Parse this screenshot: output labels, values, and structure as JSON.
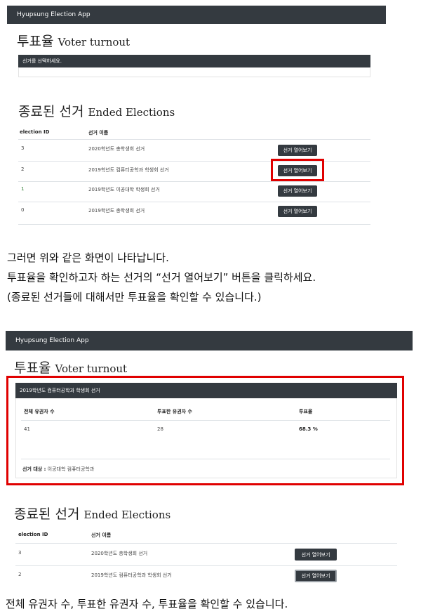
{
  "screen1": {
    "app_title": "Hyupsung Election App",
    "turnout_title_ko": "투표율",
    "turnout_title_en": "Voter turnout",
    "select_prompt": "선거를 선택하세요.",
    "ended_title_ko": "종료된 선거",
    "ended_title_en": "Ended Elections",
    "col_id": "election ID",
    "col_name": "선거 이름",
    "rows": [
      {
        "id": "3",
        "name": "2020학년도 총학생회 선거",
        "button": "선거 열어보기"
      },
      {
        "id": "2",
        "name": "2019학년도 컴퓨터공학과 학생회 선거",
        "button": "선거 열어보기"
      },
      {
        "id": "1",
        "name": "2019학년도 이공대학 학생회 선거",
        "button": "선거 열어보기"
      },
      {
        "id": "0",
        "name": "2019학년도 총학생회 선거",
        "button": "선거 열어보기"
      }
    ]
  },
  "instructions": {
    "line1": "그러면 위와 같은 화면이 나타납니다.",
    "line2": "투표율을 확인하고자 하는 선거의 “선거 열어보기” 버튼을 클릭하세요.",
    "line3": "(종료된 선거들에 대해서만 투표율을 확인할 수 있습니다.)"
  },
  "screen2": {
    "app_title": "Hyupsung Election App",
    "turnout_title_ko": "투표율",
    "turnout_title_en": "Voter turnout",
    "election_name": "2019학년도 컴퓨터공학과 학생회 선거",
    "stats_headers": {
      "total": "전체 유권자 수",
      "voted": "투표한 유권자 수",
      "rate": "투표율"
    },
    "stats_values": {
      "total": "41",
      "voted": "28",
      "rate": "68.3 %"
    },
    "target_label": "선거 대상 :",
    "target_value": "이공대학 컴퓨터공학과",
    "ended_title_ko": "종료된 선거",
    "ended_title_en": "Ended Elections",
    "col_id": "election ID",
    "col_name": "선거 이름",
    "rows": [
      {
        "id": "3",
        "name": "2020학년도 총학생회 선거",
        "button": "선거 열어보기"
      },
      {
        "id": "2",
        "name": "2019학년도 컴퓨터공학과 학생회 선거",
        "button": "선거 열어보기"
      }
    ]
  },
  "bottom_caption": "전체 유권자 수, 투표한 유권자 수, 투표율을 확인할 수 있습니다.",
  "colors": {
    "navbar": "#343a40",
    "highlight": "#e00000"
  }
}
